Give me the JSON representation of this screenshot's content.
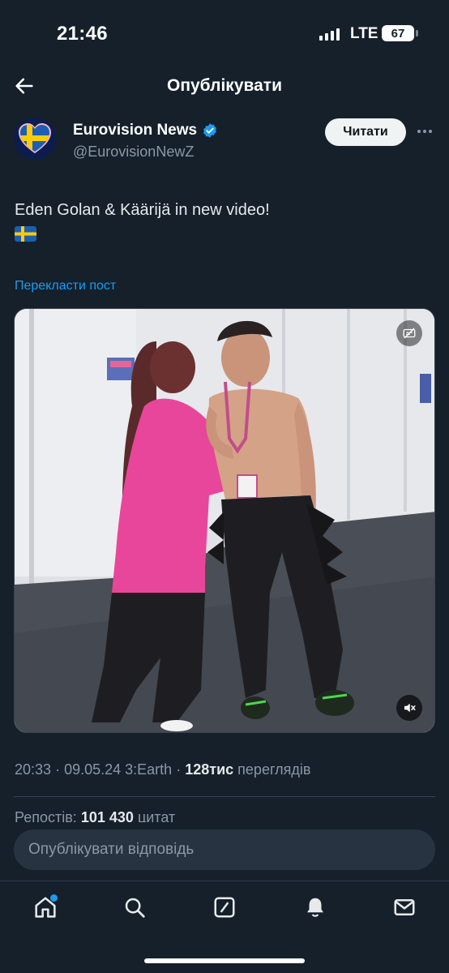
{
  "status_bar": {
    "time": "21:46",
    "network": "LTE",
    "battery": "67"
  },
  "header": {
    "title": "Опублікувати",
    "back_icon": "arrow-left-icon"
  },
  "author": {
    "name": "Eurovision News",
    "handle": "@EurovisionNewZ",
    "verified": true,
    "follow_label": "Читати"
  },
  "post": {
    "text": "Eden Golan & Käärijä in new video!",
    "translate_label": "Перекласти пост"
  },
  "meta": {
    "time": "20:33",
    "date": "09.05.24",
    "source": "3:Earth",
    "views_count": "128тис",
    "views_label": "переглядів"
  },
  "stats": {
    "reposts_label": "Репостів:",
    "reposts_count": "101",
    "quotes_count": "430",
    "quotes_label": "цитат"
  },
  "reply": {
    "placeholder": "Опублікувати відповідь"
  },
  "tabs": [
    {
      "icon": "home-icon"
    },
    {
      "icon": "search-icon"
    },
    {
      "icon": "compose-icon"
    },
    {
      "icon": "notifications-icon"
    },
    {
      "icon": "messages-icon"
    }
  ],
  "colors": {
    "background": "#15202b",
    "accent": "#1d9bf0",
    "secondary_text": "#8b98a5"
  }
}
